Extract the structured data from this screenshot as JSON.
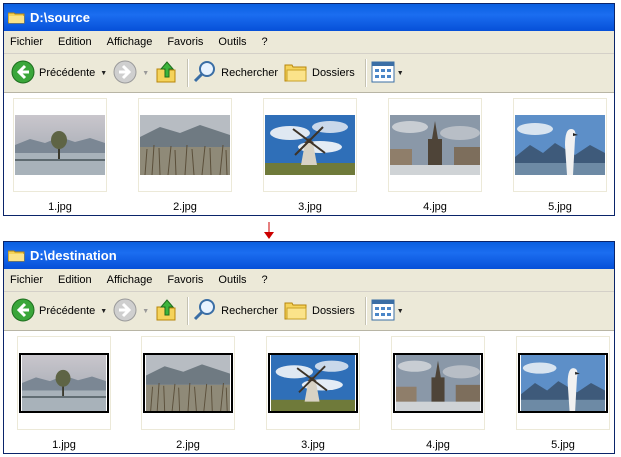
{
  "windows": [
    {
      "title": "D:\\source",
      "menu": [
        "Fichier",
        "Edition",
        "Affichage",
        "Favoris",
        "Outils",
        "?"
      ],
      "toolbar": {
        "back": "Précédente",
        "search": "Rechercher",
        "folders": "Dossiers"
      },
      "files": [
        "1.jpg",
        "2.jpg",
        "3.jpg",
        "4.jpg",
        "5.jpg"
      ]
    },
    {
      "title": "D:\\destination",
      "menu": [
        "Fichier",
        "Edition",
        "Affichage",
        "Favoris",
        "Outils",
        "?"
      ],
      "toolbar": {
        "back": "Précédente",
        "search": "Rechercher",
        "folders": "Dossiers"
      },
      "files": [
        "1.jpg",
        "2.jpg",
        "3.jpg",
        "4.jpg",
        "5.jpg"
      ]
    }
  ],
  "thumbnails": [
    "lake-tree-photo",
    "reeds-lake-photo",
    "windmill-photo",
    "cathedral-square-photo",
    "swan-mountains-photo"
  ],
  "colors": {
    "titlebar": "#0a5fe0",
    "arrow": "#cc0000",
    "chrome": "#ece9d8"
  }
}
